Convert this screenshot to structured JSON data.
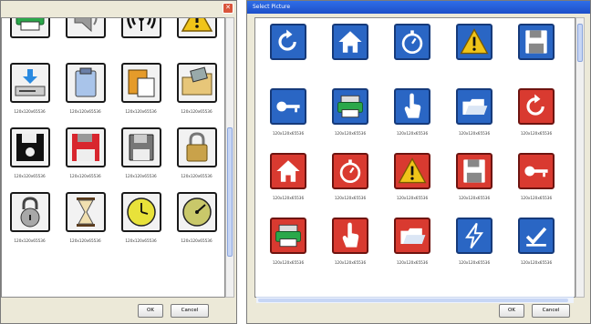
{
  "left_dialog": {
    "items": [
      {
        "icon": "printer-icon",
        "tile": "gray",
        "labels": [
          "",
          ""
        ]
      },
      {
        "icon": "speaker-icon",
        "tile": "gray",
        "labels": [
          "",
          ""
        ]
      },
      {
        "icon": "wireless-icon",
        "tile": "gray",
        "labels": [
          "",
          ""
        ]
      },
      {
        "icon": "warning-icon",
        "tile": "gray",
        "labels": [
          "",
          ""
        ]
      },
      {
        "icon": "download-drive-icon",
        "tile": "gray",
        "labels": [
          "",
          "120x120x65536"
        ]
      },
      {
        "icon": "clipboard-icon",
        "tile": "gray",
        "labels": [
          "",
          "120x120x65536"
        ]
      },
      {
        "icon": "paste-icon",
        "tile": "gray",
        "labels": [
          "",
          "120x120x65536"
        ]
      },
      {
        "icon": "folder-icon",
        "tile": "gray",
        "labels": [
          "",
          "120x120x65536"
        ]
      },
      {
        "icon": "floppy-black-icon",
        "tile": "gray",
        "labels": [
          "",
          "120x120x65536"
        ]
      },
      {
        "icon": "floppy-red-icon",
        "tile": "gray",
        "labels": [
          "",
          "120x120x65536"
        ]
      },
      {
        "icon": "floppy-gray-icon",
        "tile": "gray",
        "labels": [
          "",
          "120x120x65536"
        ]
      },
      {
        "icon": "padlock-icon",
        "tile": "gray",
        "labels": [
          "",
          "120x120x65536"
        ]
      },
      {
        "icon": "padlock-round-icon",
        "tile": "gray",
        "labels": [
          "",
          "120x120x65536"
        ]
      },
      {
        "icon": "hourglass-icon",
        "tile": "gray",
        "labels": [
          "",
          "120x120x65536"
        ]
      },
      {
        "icon": "clock-icon",
        "tile": "gray",
        "labels": [
          "",
          "120x120x65536"
        ]
      },
      {
        "icon": "gauge-icon",
        "tile": "gray",
        "labels": [
          "",
          "120x120x65536"
        ]
      }
    ],
    "ok_label": "OK",
    "cancel_label": "Cancel"
  },
  "right_dialog": {
    "title": "Select Picture",
    "items": [
      {
        "icon": "refresh-icon",
        "tile": "blue",
        "labels": [
          "",
          ""
        ]
      },
      {
        "icon": "home-icon",
        "tile": "blue",
        "labels": [
          "",
          ""
        ]
      },
      {
        "icon": "stopwatch-icon",
        "tile": "blue",
        "labels": [
          "",
          ""
        ]
      },
      {
        "icon": "warning-icon",
        "tile": "blue",
        "labels": [
          "",
          ""
        ]
      },
      {
        "icon": "floppy-icon",
        "tile": "blue",
        "labels": [
          "",
          ""
        ]
      },
      {
        "icon": "key-icon",
        "tile": "blue",
        "labels": [
          "",
          "120x120x65536"
        ]
      },
      {
        "icon": "printer-icon",
        "tile": "blue",
        "labels": [
          "",
          "120x120x65536"
        ]
      },
      {
        "icon": "pointer-hand-icon",
        "tile": "blue",
        "labels": [
          "",
          "120x120x65536"
        ]
      },
      {
        "icon": "open-folder-icon",
        "tile": "blue",
        "labels": [
          "",
          "120x120x65536"
        ]
      },
      {
        "icon": "refresh-icon",
        "tile": "red",
        "labels": [
          "",
          "120x120x65536"
        ]
      },
      {
        "icon": "home-icon",
        "tile": "red",
        "labels": [
          "",
          "120x120x65536"
        ]
      },
      {
        "icon": "stopwatch-icon",
        "tile": "red",
        "labels": [
          "",
          "120x120x65536"
        ]
      },
      {
        "icon": "warning-icon",
        "tile": "red",
        "labels": [
          "",
          "120x120x65536"
        ]
      },
      {
        "icon": "floppy-icon",
        "tile": "red",
        "labels": [
          "",
          "120x120x65536"
        ]
      },
      {
        "icon": "key-icon",
        "tile": "red",
        "labels": [
          "",
          "120x120x65536"
        ]
      },
      {
        "icon": "printer-icon",
        "tile": "red",
        "labels": [
          "",
          "120x120x65536"
        ]
      },
      {
        "icon": "pointer-hand-icon",
        "tile": "red",
        "labels": [
          "",
          "120x120x65536"
        ]
      },
      {
        "icon": "open-folder-icon",
        "tile": "red",
        "labels": [
          "",
          "120x120x65536"
        ]
      },
      {
        "icon": "lightning-icon",
        "tile": "blue",
        "labels": [
          "",
          "120x120x65536"
        ]
      },
      {
        "icon": "checkmark-icon",
        "tile": "blue",
        "labels": [
          "",
          "120x120x65536"
        ]
      }
    ],
    "ok_label": "OK",
    "cancel_label": "Cancel"
  },
  "colors": {
    "dialog_bg": "#ece9d8",
    "title_bar": "#2f6ee8",
    "tile_red": "#d93a30",
    "tile_blue": "#2a66c4",
    "warning_yellow": "#f0c419",
    "clock_face": "#e8e23a"
  }
}
